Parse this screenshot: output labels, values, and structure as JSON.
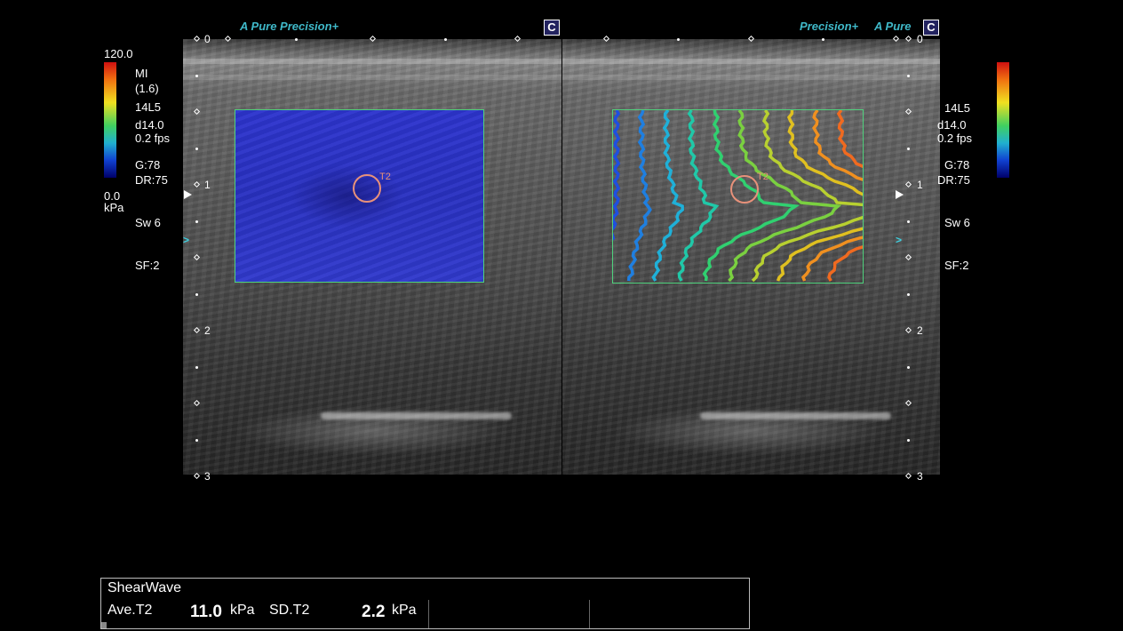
{
  "header": {
    "left_brand": "A Pure Precision+",
    "right_brand_1": "Precision+",
    "right_brand_2": "A Pure",
    "c_label": "C"
  },
  "depth_marks": [
    "0",
    "1",
    "2",
    "3"
  ],
  "left_panel": {
    "scale_max": "120.0",
    "scale_min": "0.0",
    "scale_unit": "kPa",
    "mi_label": "MI",
    "mi_value": "(1.6)",
    "probe": "14L5",
    "depth": "d14.0",
    "fps": "0.2 fps",
    "gain": "G:78",
    "dr": "DR:75",
    "sw": "Sw 6",
    "sf": "SF:2"
  },
  "right_panel": {
    "probe": "14L5",
    "depth": "d14.0",
    "fps": "0.2 fps",
    "gain": "G:78",
    "dr": "DR:75",
    "sw": "Sw 6",
    "sf": "SF:2"
  },
  "roi_label": "T2",
  "results": {
    "title": "ShearWave",
    "ave_label": "Ave.T2",
    "ave_value": "11.0",
    "ave_unit": "kPa",
    "sd_label": "SD.T2",
    "sd_value": "2.2",
    "sd_unit": "kPa"
  },
  "colors": {
    "roi": "#e8917a",
    "box_border": "#4fd27d",
    "brand": "#3fb8c8"
  }
}
